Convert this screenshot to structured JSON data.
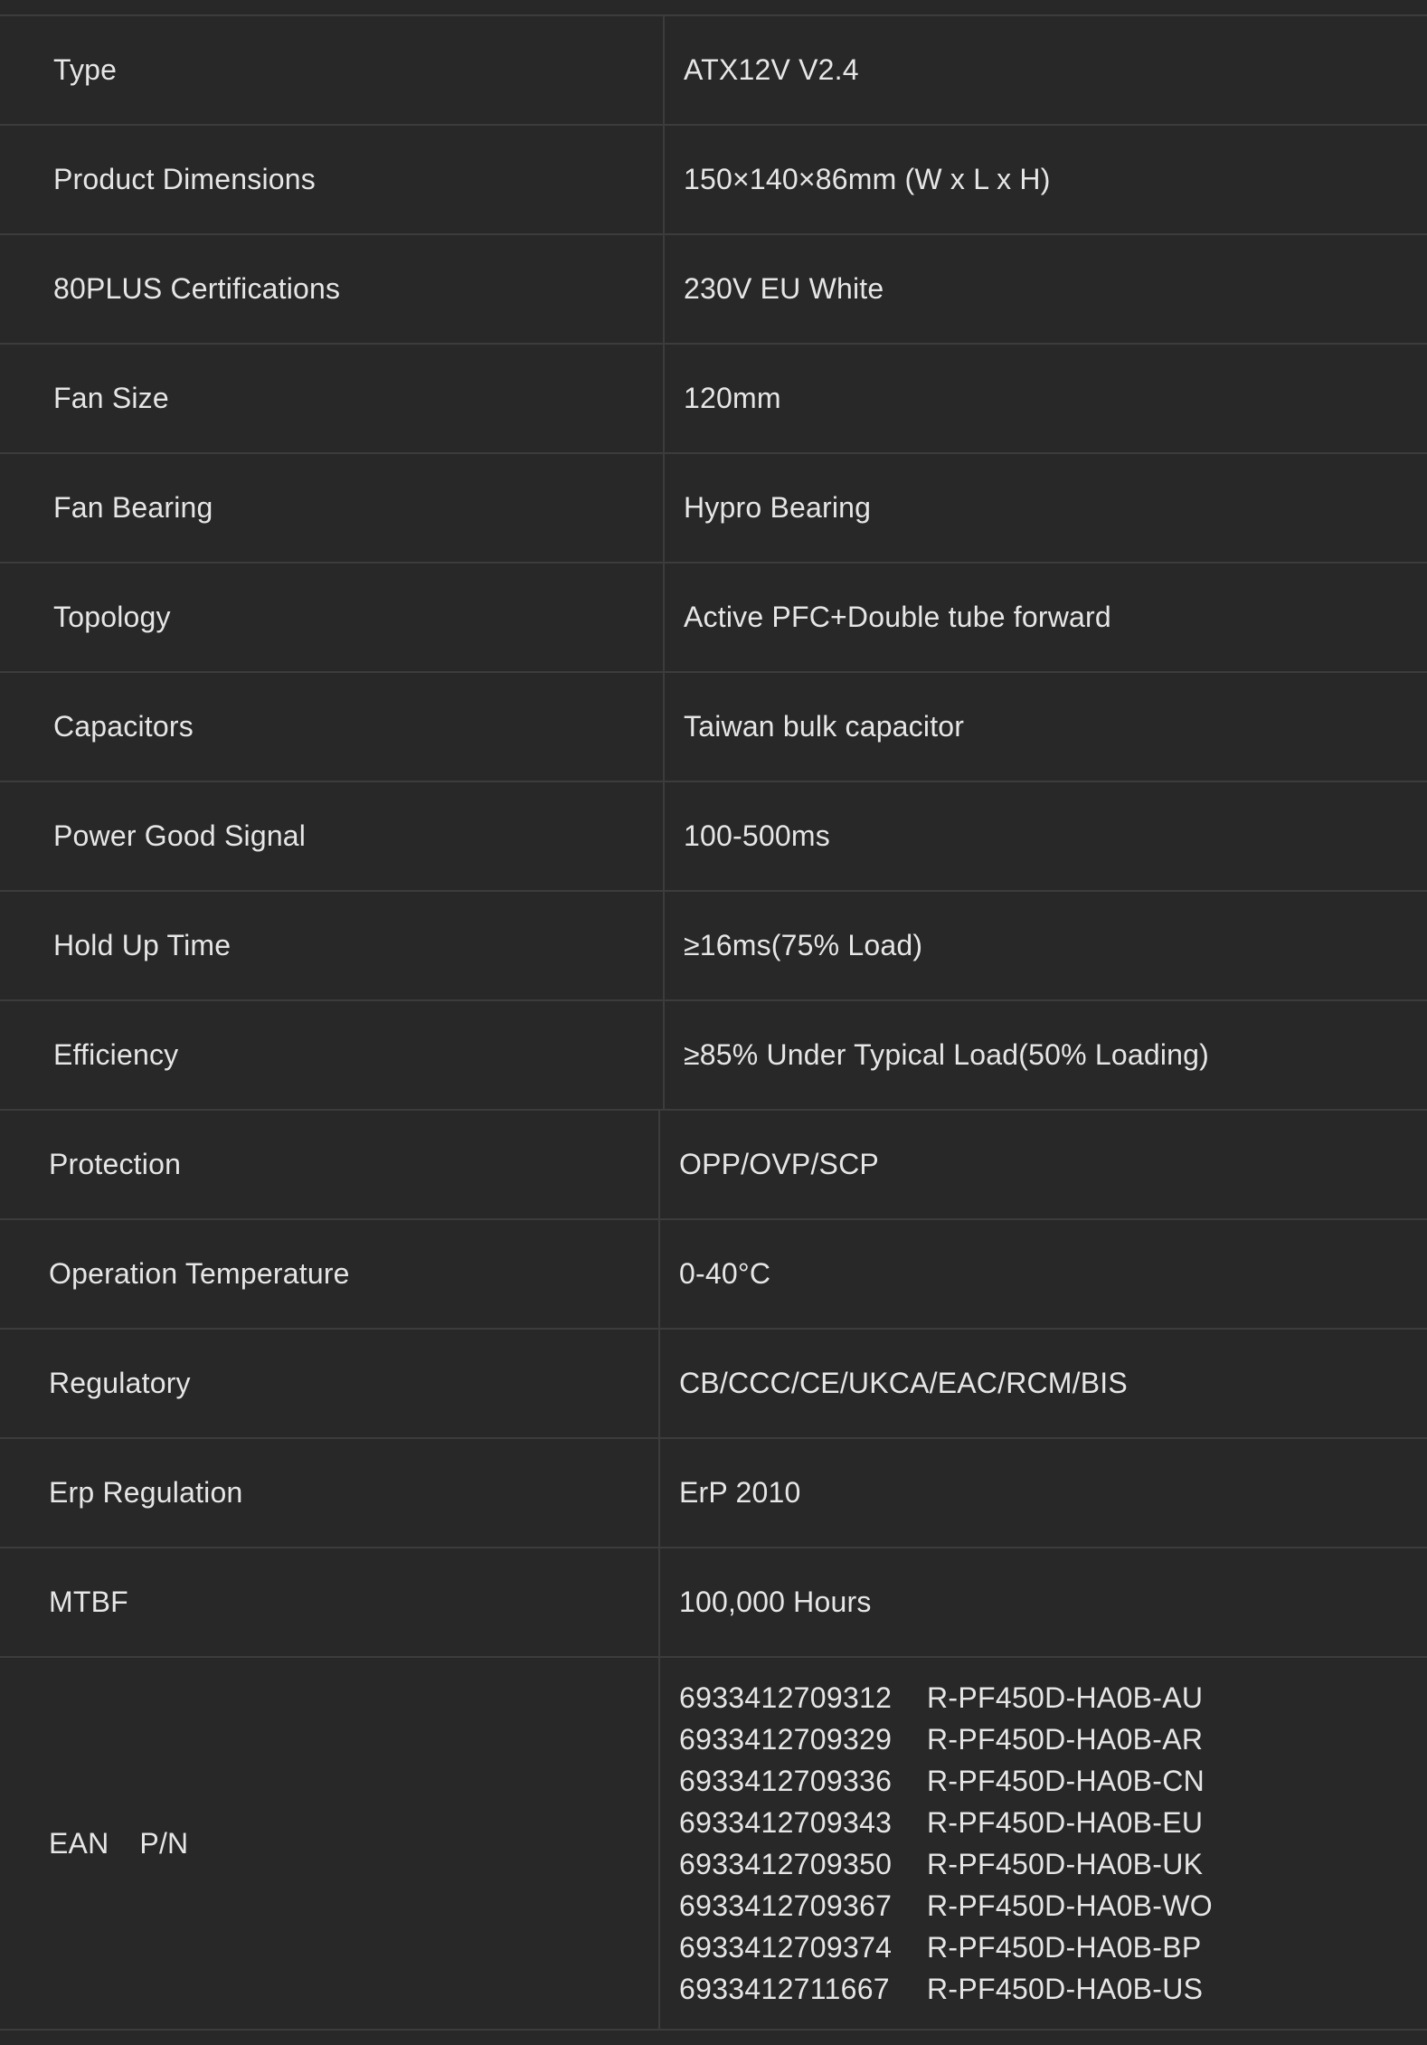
{
  "specs": [
    {
      "label": "Type",
      "value": "ATX12V V2.4"
    },
    {
      "label": "Product Dimensions",
      "value": "150×140×86mm (W x L x H)"
    },
    {
      "label": "80PLUS Certifications",
      "value": "230V EU White"
    },
    {
      "label": "Fan Size",
      "value": "120mm"
    },
    {
      "label": "Fan Bearing",
      "value": "Hypro Bearing"
    },
    {
      "label": "Topology",
      "value": "Active PFC+Double tube forward"
    },
    {
      "label": "Capacitors",
      "value": "Taiwan bulk capacitor"
    },
    {
      "label": "Power Good Signal",
      "value": "100-500ms"
    },
    {
      "label": "Hold Up Time",
      "value": "≥16ms(75% Load)"
    },
    {
      "label": "Efficiency",
      "value": "≥85% Under Typical Load(50% Loading)"
    },
    {
      "label": "Protection",
      "value": "OPP/OVP/SCP"
    },
    {
      "label": "Operation Temperature",
      "value": "0-40°C"
    },
    {
      "label": "Regulatory",
      "value": "CB/CCC/CE/UKCA/EAC/RCM/BIS"
    },
    {
      "label": "Erp Regulation",
      "value": "ErP 2010"
    },
    {
      "label": "MTBF",
      "value": "100,000 Hours"
    }
  ],
  "ean_pn": {
    "label_ean": "EAN",
    "label_pn": "P/N",
    "entries": [
      {
        "ean": "6933412709312",
        "pn": "R-PF450D-HA0B-AU"
      },
      {
        "ean": "6933412709329",
        "pn": "R-PF450D-HA0B-AR"
      },
      {
        "ean": "6933412709336",
        "pn": "R-PF450D-HA0B-CN"
      },
      {
        "ean": "6933412709343",
        "pn": "R-PF450D-HA0B-EU"
      },
      {
        "ean": "6933412709350",
        "pn": "R-PF450D-HA0B-UK"
      },
      {
        "ean": "6933412709367",
        "pn": "R-PF450D-HA0B-WO"
      },
      {
        "ean": "6933412709374",
        "pn": "R-PF450D-HA0B-BP"
      },
      {
        "ean": "6933412711667",
        "pn": "R-PF450D-HA0B-US"
      }
    ]
  }
}
